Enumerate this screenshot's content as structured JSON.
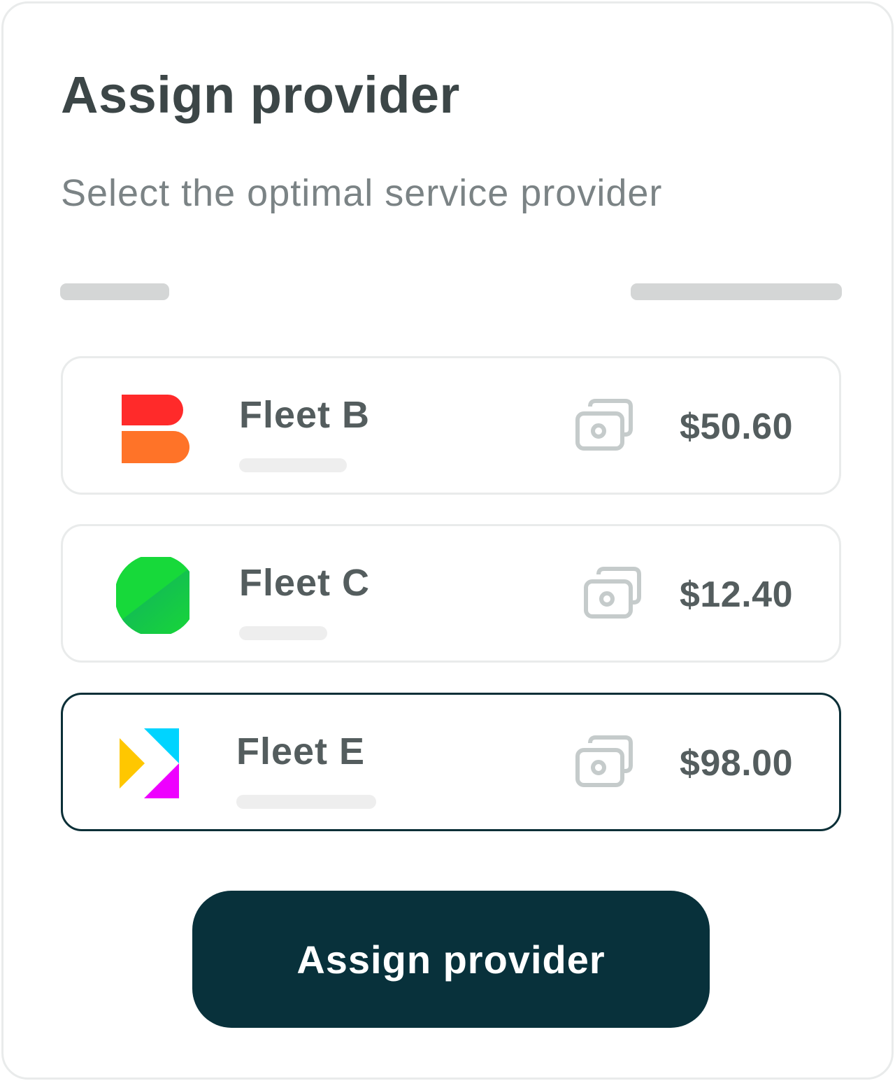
{
  "header": {
    "title": "Assign provider",
    "subtitle": "Select the optimal service provider"
  },
  "providers": [
    {
      "name": "Fleet B",
      "price": "$50.60",
      "logo_icon": "fleet-b-logo",
      "cost_icon": "wallet-icon",
      "selected": false,
      "brand_colors": [
        "#ff2a2a",
        "#ff7328"
      ]
    },
    {
      "name": "Fleet C",
      "price": "$12.40",
      "logo_icon": "fleet-c-logo",
      "cost_icon": "wallet-icon",
      "selected": false,
      "brand_colors": [
        "#17d93a",
        "#10b85a"
      ]
    },
    {
      "name": "Fleet E",
      "price": "$98.00",
      "logo_icon": "fleet-e-logo",
      "cost_icon": "wallet-icon",
      "selected": true,
      "brand_colors": [
        "#00d4ff",
        "#ffc700",
        "#ee00ff"
      ]
    }
  ],
  "actions": {
    "assign_label": "Assign provider"
  },
  "colors": {
    "primary": "#08313b",
    "card_border": "#e9ebeb",
    "selected_border": "#0b2f37",
    "title_text": "#3c4647",
    "subtitle_text": "#7b8385",
    "body_text": "#545d5e",
    "icon_stroke": "#c5cbcb",
    "skeleton": "#d4d6d6"
  }
}
